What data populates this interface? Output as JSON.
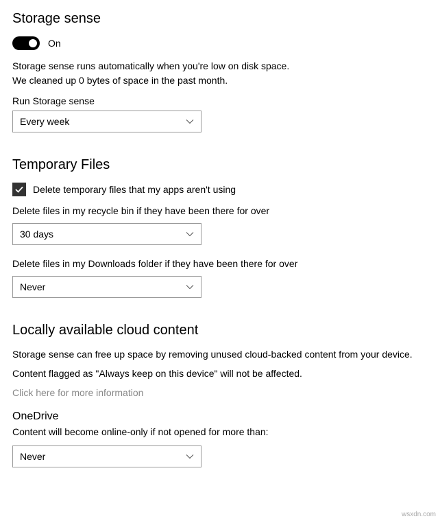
{
  "storageSense": {
    "heading": "Storage sense",
    "toggleState": "On",
    "desc1": "Storage sense runs automatically when you're low on disk space.",
    "desc2": "We cleaned up 0 bytes of space in the past month.",
    "runLabel": "Run Storage sense",
    "runValue": "Every week"
  },
  "tempFiles": {
    "heading": "Temporary Files",
    "checkboxLabel": "Delete temporary files that my apps aren't using",
    "recycleLabel": "Delete files in my recycle bin if they have been there for over",
    "recycleValue": "30 days",
    "downloadsLabel": "Delete files in my Downloads folder if they have been there for over",
    "downloadsValue": "Never"
  },
  "cloud": {
    "heading": "Locally available cloud content",
    "desc1": "Storage sense can free up space by removing unused cloud-backed content from your device.",
    "desc2": "Content flagged as \"Always keep on this device\" will not be affected.",
    "link": "Click here for more information",
    "onedriveHeading": "OneDrive",
    "onedriveDesc": "Content will become online-only if not opened for more than:",
    "onedriveValue": "Never"
  },
  "watermark": "wsxdn.com"
}
